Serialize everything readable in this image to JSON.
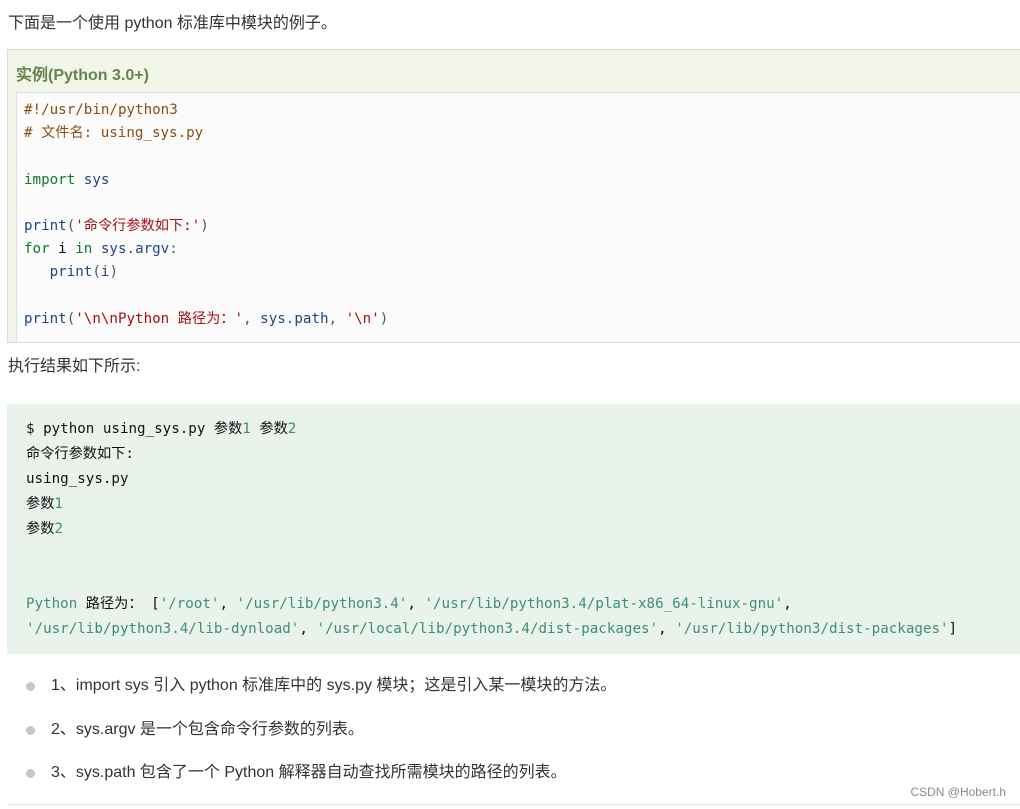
{
  "intro_text": "下面是一个使用 python 标准库中模块的例子。",
  "example": {
    "title": "实例(Python 3.0+)",
    "code_lines": [
      [
        {
          "t": "#!/usr/bin/python3",
          "c": "cmt"
        }
      ],
      [
        {
          "t": "# 文件名: using_sys.py",
          "c": "cmt"
        }
      ],
      [],
      [
        {
          "t": "import",
          "c": "kw"
        },
        {
          "t": " "
        },
        {
          "t": "sys",
          "c": "fn"
        }
      ],
      [],
      [
        {
          "t": "print",
          "c": "fn"
        },
        {
          "t": "(",
          "c": "pl"
        },
        {
          "t": "'命令行参数如下:'",
          "c": "str"
        },
        {
          "t": ")",
          "c": "pl"
        }
      ],
      [
        {
          "t": "for",
          "c": "kw"
        },
        {
          "t": " i "
        },
        {
          "t": "in",
          "c": "kw"
        },
        {
          "t": " "
        },
        {
          "t": "sys",
          "c": "fn"
        },
        {
          "t": ".",
          "c": "pl"
        },
        {
          "t": "argv",
          "c": "fn"
        },
        {
          "t": ":",
          "c": "pl"
        }
      ],
      [
        {
          "t": "   "
        },
        {
          "t": "print",
          "c": "fn"
        },
        {
          "t": "(",
          "c": "pl"
        },
        {
          "t": "i",
          "c": "fn"
        },
        {
          "t": ")",
          "c": "pl"
        }
      ],
      [],
      [
        {
          "t": "print",
          "c": "fn"
        },
        {
          "t": "(",
          "c": "pl"
        },
        {
          "t": "'\\n\\nPython 路径为：'",
          "c": "str"
        },
        {
          "t": ", ",
          "c": "pl"
        },
        {
          "t": "sys",
          "c": "fn"
        },
        {
          "t": ".",
          "c": "pl"
        },
        {
          "t": "path",
          "c": "fn"
        },
        {
          "t": ", ",
          "c": "pl"
        },
        {
          "t": "'\\n'",
          "c": "str"
        },
        {
          "t": ")",
          "c": "pl"
        }
      ]
    ]
  },
  "result_label": "执行结果如下所示:",
  "output_lines": [
    [
      {
        "t": "$ python using_sys.py 参数"
      },
      {
        "t": "1",
        "c": "num"
      },
      {
        "t": " 参数"
      },
      {
        "t": "2",
        "c": "num"
      }
    ],
    [
      {
        "t": "命令行参数如下:"
      }
    ],
    [
      {
        "t": "using_sys.py"
      }
    ],
    [
      {
        "t": "参数"
      },
      {
        "t": "1",
        "c": "num"
      }
    ],
    [
      {
        "t": "参数"
      },
      {
        "t": "2",
        "c": "num"
      }
    ],
    [],
    [],
    [
      {
        "t": "Python",
        "c": "teal"
      },
      {
        "t": " 路径为： ["
      },
      {
        "t": "'/root'",
        "c": "teal"
      },
      {
        "t": ", "
      },
      {
        "t": "'/usr/lib/python3.4'",
        "c": "teal"
      },
      {
        "t": ", "
      },
      {
        "t": "'/usr/lib/python3.4/plat-x86_64-linux-gnu'",
        "c": "teal"
      },
      {
        "t": ","
      }
    ],
    [
      {
        "t": "'/usr/lib/python3.4/lib-dynload'",
        "c": "teal"
      },
      {
        "t": ", "
      },
      {
        "t": "'/usr/local/lib/python3.4/dist-packages'",
        "c": "teal"
      },
      {
        "t": ", "
      },
      {
        "t": "'/usr/lib/python3/dist-packages'",
        "c": "teal"
      },
      {
        "t": "]"
      }
    ]
  ],
  "bullets": [
    "1、import sys 引入 python 标准库中的 sys.py 模块；这是引入某一模块的方法。",
    "2、sys.argv 是一个包含命令行参数的列表。",
    "3、sys.path 包含了一个 Python 解释器自动查找所需模块的路径的列表。"
  ],
  "watermark": "CSDN @Hobert.h",
  "colors": {
    "example_title": "#64854c",
    "example_bg": "#f2f6e9",
    "output_bg": "#eaf2ec",
    "keyword": "#0a7c2b",
    "comment": "#8c4e14",
    "string": "#a11115",
    "name": "#21467e"
  }
}
